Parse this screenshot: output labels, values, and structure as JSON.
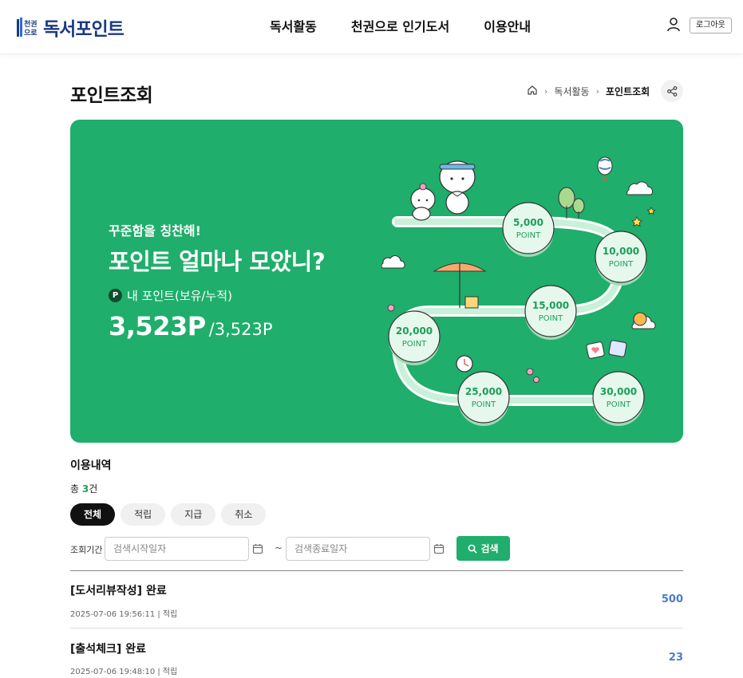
{
  "header": {
    "logo_text": "독서포인트",
    "logo_mark_text": [
      "천권",
      "으로"
    ],
    "nav": [
      "독서활동",
      "천권으로 인기도서",
      "이용안내"
    ],
    "logout_label": "로그아웃"
  },
  "page": {
    "title": "포인트조회",
    "breadcrumb": [
      "독서활동",
      "포인트조회"
    ]
  },
  "banner": {
    "subtitle": "꾸준함을 칭찬해!",
    "headline": "포인트 얼마나 모았니?",
    "badge": "P",
    "my_point_label": "내 포인트(보유/누적)",
    "current_points": "3,523P",
    "total_points": "/3,523P",
    "milestones": [
      {
        "amount": "5,000",
        "unit": "POINT"
      },
      {
        "amount": "10,000",
        "unit": "POINT"
      },
      {
        "amount": "15,000",
        "unit": "POINT"
      },
      {
        "amount": "20,000",
        "unit": "POINT"
      },
      {
        "amount": "25,000",
        "unit": "POINT"
      },
      {
        "amount": "30,000",
        "unit": "POINT"
      }
    ],
    "color": "#1fae6b"
  },
  "history": {
    "title": "이용내역",
    "count_prefix": "총 ",
    "count": "3",
    "count_suffix": "건",
    "filters": [
      "전체",
      "적립",
      "지급",
      "취소"
    ],
    "active_filter": "전체",
    "period_label": "조회기간",
    "start_placeholder": "검색시작일자",
    "end_placeholder": "검색종료일자",
    "separator": "~",
    "search_label": "검색",
    "items": [
      {
        "title": "[도서리뷰작성] 완료",
        "meta": "2025-07-06 19:56:11 | 적립",
        "points": "500"
      },
      {
        "title": "[출석체크] 완료",
        "meta": "2025-07-06 19:48:10 | 적립",
        "points": "23"
      }
    ]
  },
  "colors": {
    "accent": "#1fae6b",
    "point_value": "#4a7cc9",
    "brand": "#1b3a84"
  }
}
